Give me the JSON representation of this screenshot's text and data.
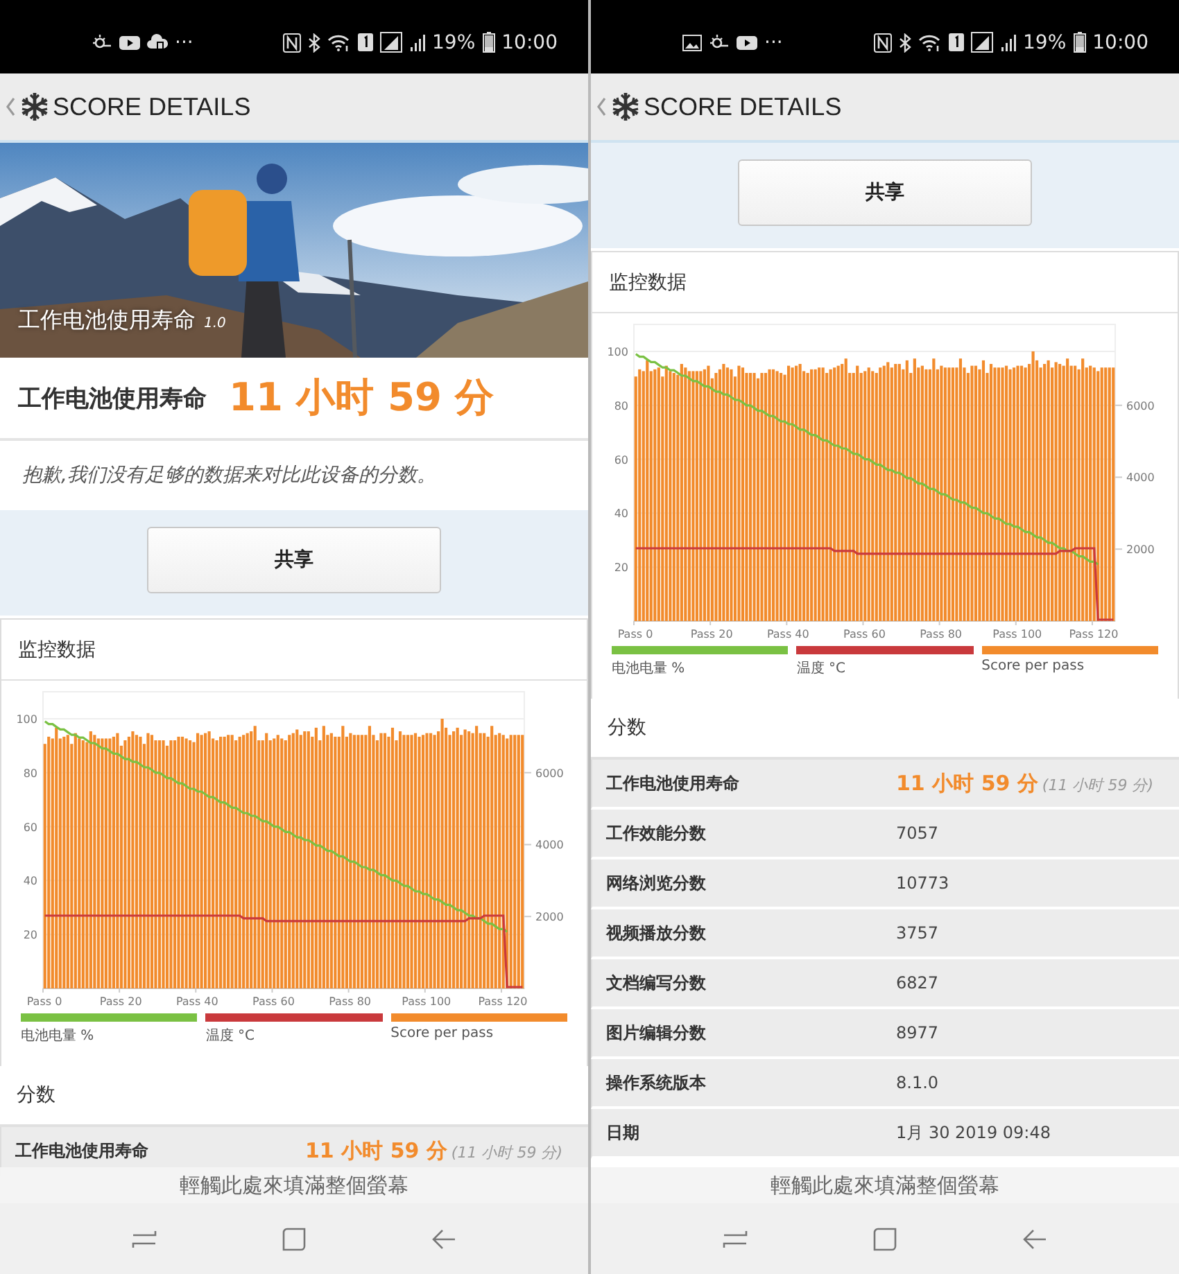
{
  "screens": [
    {
      "status_bar": {
        "more": "···",
        "battery": "19%",
        "time": "10:00"
      },
      "header": {
        "title": "SCORE DETAILS"
      },
      "sections": [
        {
          "kind": "hero",
          "title": "工作电池使用寿命",
          "version": "1.0"
        },
        {
          "kind": "result",
          "label": "工作电池使用寿命",
          "value": "11 小时 59 分"
        },
        {
          "kind": "note",
          "text": "抱歉,我们没有足够的数据来对比此设备的分数。"
        },
        {
          "kind": "share",
          "button": "共享"
        },
        {
          "kind": "monitor",
          "title": "监控数据",
          "chart_data": {
            "type": "line",
            "grid": true,
            "ylim": [
              0,
              110
            ],
            "y2lim": [
              0,
              8250
            ],
            "categories": [
              "Pass 0",
              null,
              null,
              null,
              null,
              null,
              null,
              null,
              null,
              null,
              null,
              null,
              null,
              null,
              null,
              null,
              null,
              null,
              null,
              null,
              "Pass 20",
              null,
              null,
              null,
              null,
              null,
              null,
              null,
              null,
              null,
              null,
              null,
              null,
              null,
              null,
              null,
              null,
              null,
              null,
              null,
              "Pass 40",
              null,
              null,
              null,
              null,
              null,
              null,
              null,
              null,
              null,
              null,
              null,
              null,
              null,
              null,
              null,
              null,
              null,
              null,
              null,
              "Pass 60",
              null,
              null,
              null,
              null,
              null,
              null,
              null,
              null,
              null,
              null,
              null,
              null,
              null,
              null,
              null,
              null,
              null,
              null,
              null,
              "Pass 80",
              null,
              null,
              null,
              null,
              null,
              null,
              null,
              null,
              null,
              null,
              null,
              null,
              null,
              null,
              null,
              null,
              null,
              null,
              null,
              "Pass 100",
              null,
              null,
              null,
              null,
              null,
              null,
              null,
              null,
              null,
              null,
              null,
              null,
              null,
              null,
              null,
              null,
              null,
              null,
              null,
              "Pass 120",
              null,
              null,
              null,
              null,
              null
            ],
            "yticks": [
              20,
              40,
              60,
              80,
              100
            ],
            "y2ticks": [
              2000,
              4000,
              6000
            ],
            "series": [
              {
                "name": "电池电量 %",
                "color": "#7ac143",
                "values": [
                  99,
                  98,
                  98,
                  97,
                  96,
                  96,
                  95,
                  94,
                  94,
                  93,
                  93,
                  92,
                  91,
                  91,
                  90,
                  89,
                  89,
                  88,
                  87,
                  87,
                  86,
                  85,
                  85,
                  84,
                  84,
                  83,
                  82,
                  82,
                  81,
                  80,
                  80,
                  79,
                  78,
                  78,
                  77,
                  76,
                  76,
                  75,
                  74,
                  74,
                  73,
                  73,
                  72,
                  71,
                  71,
                  70,
                  69,
                  69,
                  68,
                  67,
                  67,
                  66,
                  65,
                  65,
                  64,
                  64,
                  63,
                  62,
                  62,
                  61,
                  60,
                  60,
                  59,
                  58,
                  58,
                  57,
                  56,
                  56,
                  55,
                  55,
                  54,
                  53,
                  53,
                  52,
                  51,
                  51,
                  50,
                  49,
                  49,
                  48,
                  47,
                  47,
                  46,
                  45,
                  45,
                  44,
                  44,
                  43,
                  42,
                  42,
                  41,
                  40,
                  40,
                  39,
                  38,
                  38,
                  37,
                  36,
                  36,
                  35,
                  35,
                  34,
                  33,
                  33,
                  32,
                  31,
                  31,
                  30,
                  29,
                  29,
                  28,
                  27,
                  27,
                  26,
                  26,
                  25,
                  24,
                  24,
                  23,
                  22,
                  22,
                  21,
                  null,
                  null,
                  null,
                  null
                ]
              },
              {
                "name": "温度 °C",
                "color": "#c9393c",
                "values": [
                  27,
                  27,
                  27,
                  27,
                  27,
                  27,
                  27,
                  27,
                  27,
                  27,
                  27,
                  27,
                  27,
                  27,
                  27,
                  27,
                  27,
                  27,
                  27,
                  27,
                  27,
                  27,
                  27,
                  27,
                  27,
                  27,
                  27,
                  27,
                  27,
                  27,
                  27,
                  27,
                  27,
                  27,
                  27,
                  27,
                  27,
                  27,
                  27,
                  27,
                  27,
                  27,
                  27,
                  27,
                  27,
                  27,
                  27,
                  27,
                  27,
                  27,
                  27,
                  27,
                  26,
                  26,
                  26,
                  26,
                  26,
                  26,
                  25,
                  25,
                  25,
                  25,
                  25,
                  25,
                  25,
                  25,
                  25,
                  25,
                  25,
                  25,
                  25,
                  25,
                  25,
                  25,
                  25,
                  25,
                  25,
                  25,
                  25,
                  25,
                  25,
                  25,
                  25,
                  25,
                  25,
                  25,
                  25,
                  25,
                  25,
                  25,
                  25,
                  25,
                  25,
                  25,
                  25,
                  25,
                  25,
                  25,
                  25,
                  25,
                  25,
                  25,
                  25,
                  25,
                  25,
                  25,
                  25,
                  25,
                  25,
                  25,
                  25,
                  26,
                  26,
                  26,
                  26,
                  27,
                  27,
                  27,
                  27,
                  27,
                  27,
                  0,
                  0,
                  0,
                  0,
                  0
                ]
              },
              {
                "name": "Score per pass",
                "color": "#f28b2c",
                "type": "bar",
                "axis": "y2",
                "values": [
                  6800,
                  7000,
                  6950,
                  7250,
                  6950,
                  7000,
                  7050,
                  6800,
                  7100,
                  6950,
                  6900,
                  6850,
                  7150,
                  7050,
                  6950,
                  6950,
                  6950,
                  6950,
                  7000,
                  7100,
                  6750,
                  6900,
                  7000,
                  7150,
                  7050,
                  7000,
                  6800,
                  7100,
                  7050,
                  6900,
                  6900,
                  6900,
                  6750,
                  6900,
                  6900,
                  7000,
                  7000,
                  6950,
                  6900,
                  6850,
                  7100,
                  7050,
                  7100,
                  7150,
                  6950,
                  6900,
                  7000,
                  7000,
                  7050,
                  7050,
                  6900,
                  7000,
                  7050,
                  7100,
                  7150,
                  7300,
                  6900,
                  6900,
                  7100,
                  6900,
                  6950,
                  7050,
                  6950,
                  6900,
                  7050,
                  7100,
                  7200,
                  7050,
                  7150,
                  7150,
                  7000,
                  7250,
                  6900,
                  7300,
                  7050,
                  7100,
                  7000,
                  7000,
                  7300,
                  7000,
                  7100,
                  7050,
                  7050,
                  7050,
                  7050,
                  7300,
                  7050,
                  6900,
                  7100,
                  7100,
                  7000,
                  7250,
                  6900,
                  7150,
                  7050,
                  7050,
                  7050,
                  7100,
                  7000,
                  7050,
                  7100,
                  7100,
                  7050,
                  7150,
                  7500,
                  7250,
                  7050,
                  7150,
                  7250,
                  7050,
                  7200,
                  7150,
                  7100,
                  7300,
                  7100,
                  7100,
                  7000,
                  7300,
                  7050,
                  7100,
                  7050,
                  6950,
                  7050,
                  7050,
                  7050,
                  7050
                ]
              }
            ]
          }
        },
        {
          "kind": "scores",
          "title": "分数",
          "rows": [
            {
              "kind": "primary",
              "label": "工作电池使用寿命",
              "value": "11 小时 59 分",
              "detail": "(11 小时 59 分)"
            }
          ]
        }
      ],
      "banner": "輕觸此處來填滿整個螢幕"
    },
    {
      "status_bar": {
        "more": "···",
        "battery": "19%",
        "time": "10:00"
      },
      "header": {
        "title": "SCORE DETAILS"
      },
      "sections": [
        {
          "kind": "share",
          "button": "共享"
        },
        {
          "kind": "monitor",
          "title": "监控数据",
          "chart_data": {
            "type": "line",
            "grid": true,
            "ylim": [
              0,
              110
            ],
            "y2lim": [
              0,
              8250
            ],
            "categories": [
              "Pass 0",
              null,
              null,
              null,
              null,
              null,
              null,
              null,
              null,
              null,
              null,
              null,
              null,
              null,
              null,
              null,
              null,
              null,
              null,
              null,
              "Pass 20",
              null,
              null,
              null,
              null,
              null,
              null,
              null,
              null,
              null,
              null,
              null,
              null,
              null,
              null,
              null,
              null,
              null,
              null,
              null,
              "Pass 40",
              null,
              null,
              null,
              null,
              null,
              null,
              null,
              null,
              null,
              null,
              null,
              null,
              null,
              null,
              null,
              null,
              null,
              null,
              null,
              "Pass 60",
              null,
              null,
              null,
              null,
              null,
              null,
              null,
              null,
              null,
              null,
              null,
              null,
              null,
              null,
              null,
              null,
              null,
              null,
              null,
              "Pass 80",
              null,
              null,
              null,
              null,
              null,
              null,
              null,
              null,
              null,
              null,
              null,
              null,
              null,
              null,
              null,
              null,
              null,
              null,
              null,
              "Pass 100",
              null,
              null,
              null,
              null,
              null,
              null,
              null,
              null,
              null,
              null,
              null,
              null,
              null,
              null,
              null,
              null,
              null,
              null,
              null,
              "Pass 120",
              null,
              null,
              null,
              null,
              null
            ],
            "yticks": [
              20,
              40,
              60,
              80,
              100
            ],
            "y2ticks": [
              2000,
              4000,
              6000
            ],
            "series": [
              {
                "name": "电池电量 %",
                "color": "#7ac143",
                "values": [
                  99,
                  98,
                  98,
                  97,
                  96,
                  96,
                  95,
                  94,
                  94,
                  93,
                  93,
                  92,
                  91,
                  91,
                  90,
                  89,
                  89,
                  88,
                  87,
                  87,
                  86,
                  85,
                  85,
                  84,
                  84,
                  83,
                  82,
                  82,
                  81,
                  80,
                  80,
                  79,
                  78,
                  78,
                  77,
                  76,
                  76,
                  75,
                  74,
                  74,
                  73,
                  73,
                  72,
                  71,
                  71,
                  70,
                  69,
                  69,
                  68,
                  67,
                  67,
                  66,
                  65,
                  65,
                  64,
                  64,
                  63,
                  62,
                  62,
                  61,
                  60,
                  60,
                  59,
                  58,
                  58,
                  57,
                  56,
                  56,
                  55,
                  55,
                  54,
                  53,
                  53,
                  52,
                  51,
                  51,
                  50,
                  49,
                  49,
                  48,
                  47,
                  47,
                  46,
                  45,
                  45,
                  44,
                  44,
                  43,
                  42,
                  42,
                  41,
                  40,
                  40,
                  39,
                  38,
                  38,
                  37,
                  36,
                  36,
                  35,
                  35,
                  34,
                  33,
                  33,
                  32,
                  31,
                  31,
                  30,
                  29,
                  29,
                  28,
                  27,
                  27,
                  26,
                  26,
                  25,
                  24,
                  24,
                  23,
                  22,
                  22,
                  21,
                  null,
                  null,
                  null,
                  null
                ]
              },
              {
                "name": "温度 °C",
                "color": "#c9393c",
                "values": [
                  27,
                  27,
                  27,
                  27,
                  27,
                  27,
                  27,
                  27,
                  27,
                  27,
                  27,
                  27,
                  27,
                  27,
                  27,
                  27,
                  27,
                  27,
                  27,
                  27,
                  27,
                  27,
                  27,
                  27,
                  27,
                  27,
                  27,
                  27,
                  27,
                  27,
                  27,
                  27,
                  27,
                  27,
                  27,
                  27,
                  27,
                  27,
                  27,
                  27,
                  27,
                  27,
                  27,
                  27,
                  27,
                  27,
                  27,
                  27,
                  27,
                  27,
                  27,
                  27,
                  26,
                  26,
                  26,
                  26,
                  26,
                  26,
                  25,
                  25,
                  25,
                  25,
                  25,
                  25,
                  25,
                  25,
                  25,
                  25,
                  25,
                  25,
                  25,
                  25,
                  25,
                  25,
                  25,
                  25,
                  25,
                  25,
                  25,
                  25,
                  25,
                  25,
                  25,
                  25,
                  25,
                  25,
                  25,
                  25,
                  25,
                  25,
                  25,
                  25,
                  25,
                  25,
                  25,
                  25,
                  25,
                  25,
                  25,
                  25,
                  25,
                  25,
                  25,
                  25,
                  25,
                  25,
                  25,
                  25,
                  25,
                  25,
                  25,
                  26,
                  26,
                  26,
                  26,
                  27,
                  27,
                  27,
                  27,
                  27,
                  27,
                  0,
                  0,
                  0,
                  0,
                  0
                ]
              },
              {
                "name": "Score per pass",
                "color": "#f28b2c",
                "type": "bar",
                "axis": "y2",
                "values": [
                  6800,
                  7000,
                  6950,
                  7250,
                  6950,
                  7000,
                  7050,
                  6800,
                  7100,
                  6950,
                  6900,
                  6850,
                  7150,
                  7050,
                  6950,
                  6950,
                  6950,
                  6950,
                  7000,
                  7100,
                  6750,
                  6900,
                  7000,
                  7150,
                  7050,
                  7000,
                  6800,
                  7100,
                  7050,
                  6900,
                  6900,
                  6900,
                  6750,
                  6900,
                  6900,
                  7000,
                  7000,
                  6950,
                  6900,
                  6850,
                  7100,
                  7050,
                  7100,
                  7150,
                  6950,
                  6900,
                  7000,
                  7000,
                  7050,
                  7050,
                  6900,
                  7000,
                  7050,
                  7100,
                  7150,
                  7300,
                  6900,
                  6900,
                  7100,
                  6900,
                  6950,
                  7050,
                  6950,
                  6900,
                  7050,
                  7100,
                  7200,
                  7050,
                  7150,
                  7150,
                  7000,
                  7250,
                  6900,
                  7300,
                  7050,
                  7100,
                  7000,
                  7000,
                  7300,
                  7000,
                  7100,
                  7050,
                  7050,
                  7050,
                  7050,
                  7300,
                  7050,
                  6900,
                  7100,
                  7100,
                  7000,
                  7250,
                  6900,
                  7150,
                  7050,
                  7050,
                  7050,
                  7100,
                  7000,
                  7050,
                  7100,
                  7100,
                  7050,
                  7150,
                  7500,
                  7250,
                  7050,
                  7150,
                  7250,
                  7050,
                  7200,
                  7150,
                  7100,
                  7300,
                  7100,
                  7100,
                  7000,
                  7300,
                  7050,
                  7100,
                  7050,
                  6950,
                  7050,
                  7050,
                  7050,
                  7050
                ]
              }
            ]
          }
        },
        {
          "kind": "scores",
          "title": "分数",
          "rows": [
            {
              "kind": "primary",
              "label": "工作电池使用寿命",
              "value": "11 小时 59 分",
              "detail": "(11 小时 59 分)"
            },
            {
              "kind": "plain",
              "label": "工作效能分数",
              "value": "7057"
            },
            {
              "kind": "plain",
              "label": "网络浏览分数",
              "value": "10773"
            },
            {
              "kind": "plain",
              "label": "视频播放分数",
              "value": "3757"
            },
            {
              "kind": "plain",
              "label": "文档编写分数",
              "value": "6827"
            },
            {
              "kind": "plain",
              "label": "图片编辑分数",
              "value": "8977"
            },
            {
              "kind": "plain",
              "label": "操作系统版本",
              "value": "8.1.0"
            },
            {
              "kind": "plain",
              "label": "日期",
              "value": "1月 30 2019 09:48"
            }
          ]
        }
      ],
      "banner": "輕觸此處來填滿整個螢幕"
    }
  ]
}
